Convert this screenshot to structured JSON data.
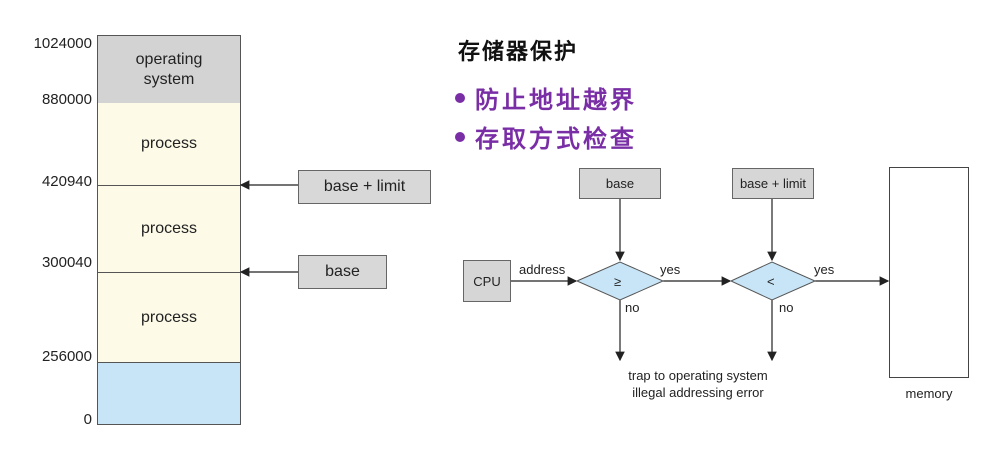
{
  "memory_map": {
    "addresses": [
      "1024000",
      "880000",
      "420940",
      "300040",
      "256000",
      "0"
    ],
    "blocks": {
      "os": "operating\nsystem",
      "process_1": "process",
      "process_2": "process",
      "process_3": "process"
    },
    "pointer_labels": {
      "base_limit": "base + limit",
      "base": "base"
    }
  },
  "heading": {
    "title": "存储器保护",
    "bullets": [
      "防止地址越界",
      "存取方式检查"
    ]
  },
  "flow": {
    "cpu": "CPU",
    "base": "base",
    "base_limit": "base + limit",
    "address_label": "address",
    "ge_symbol": "≥",
    "lt_symbol": "<",
    "yes": "yes",
    "no": "no",
    "trap_line1": "trap to operating system",
    "trap_line2": "illegal addressing error",
    "memory": "memory"
  },
  "colors": {
    "os_block": "#d3d3d3",
    "process_block": "#fdfbe8",
    "free_block": "#c7e5f7",
    "diamond": "#c7e5f7",
    "accent": "#7a2ea6"
  }
}
